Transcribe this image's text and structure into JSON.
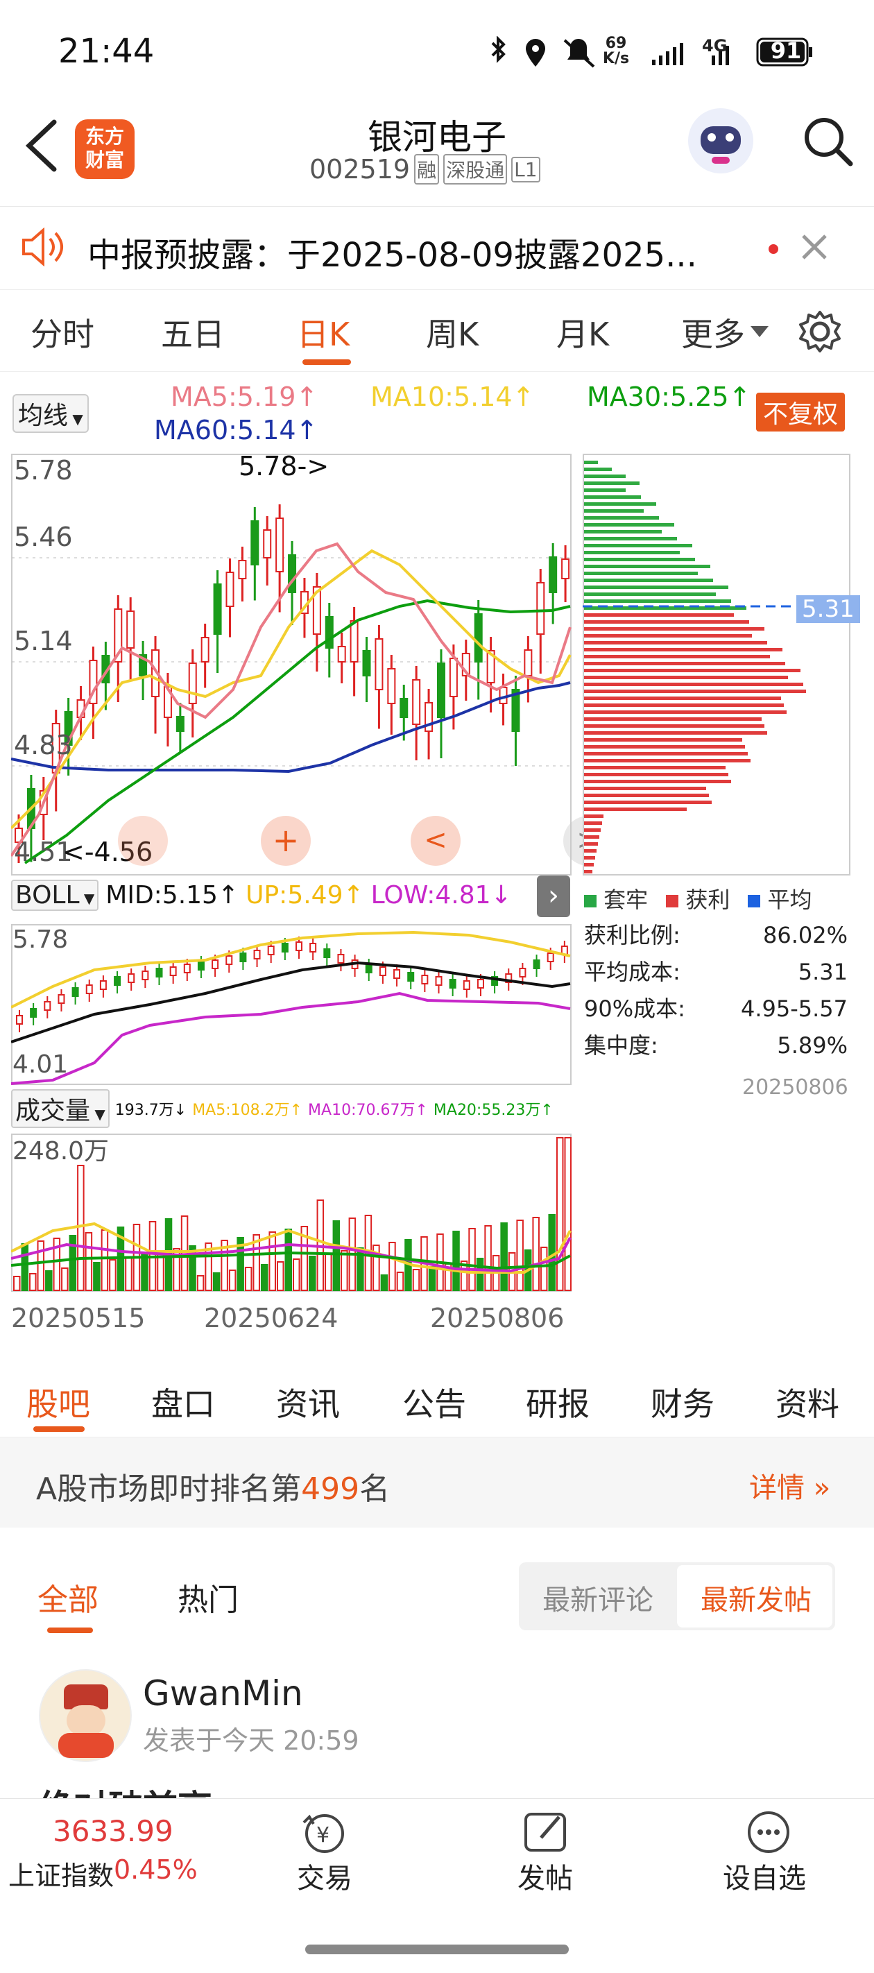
{
  "status": {
    "time": "21:44",
    "net_speed_value": "69",
    "net_speed_unit": "K/s",
    "signal": "4G",
    "battery": "91"
  },
  "header": {
    "logo_line1": "东方",
    "logo_line2": "财富",
    "stock_name": "银河电子",
    "stock_code": "002519",
    "tags": [
      "融",
      "深股通",
      "L1"
    ]
  },
  "notice": {
    "text": "中报预披露：于2025-08-09披露2025..."
  },
  "ktabs": [
    "分时",
    "五日",
    "日K",
    "周K",
    "月K",
    "更多"
  ],
  "active_ktab": "日K",
  "ma": {
    "selector": "均线",
    "ma5": "MA5:5.19↑",
    "ma10": "MA10:5.14↑",
    "ma30": "MA30:5.25↑",
    "ma60": "MA60:5.14↑",
    "fq": "不复权",
    "colors": {
      "ma5": "#ea7a86",
      "ma10": "#f2cf2f",
      "ma30": "#0d9e0f",
      "ma60": "#1d33a6"
    }
  },
  "kchart": {
    "y_labels": [
      "5.78",
      "5.46",
      "5.14",
      "4.83",
      "4.51"
    ],
    "max_label": "5.78->",
    "min_label": "<-4.56",
    "tooltip_price": "5.31"
  },
  "chip": {
    "legend": [
      "套牢",
      "获利",
      "平均"
    ],
    "rows": [
      {
        "label": "获利比例:",
        "value": "86.02%"
      },
      {
        "label": "平均成本:",
        "value": "5.31"
      },
      {
        "label": "90%成本:",
        "value": "4.95-5.57"
      },
      {
        "label": "集中度:",
        "value": "5.89%"
      }
    ],
    "date": "20250806"
  },
  "boll": {
    "selector": "BOLL",
    "mid": "MID:5.15↑",
    "up": "UP:5.49↑",
    "low": "LOW:4.81↓",
    "top": "5.78",
    "bottom": "4.01"
  },
  "volume": {
    "selector": "成交量",
    "vol": "193.7万↓",
    "ma5": "MA5:108.2万↑",
    "ma10": "MA10:70.67万↑",
    "ma20": "MA20:55.23万↑",
    "top": "248.0万"
  },
  "dates": [
    "20250515",
    "20250624",
    "20250806"
  ],
  "bottom_tabs": [
    "股吧",
    "盘口",
    "资讯",
    "公告",
    "研报",
    "财务",
    "资料"
  ],
  "rank": {
    "prefix": "A股市场即时排名第",
    "number": "499",
    "suffix": "名",
    "detail": "详情"
  },
  "feed_tabs": {
    "all": "全部",
    "hot": "热门",
    "latest_comment": "最新评论",
    "latest_post": "最新发帖"
  },
  "post": {
    "user": "GwanMin",
    "time": "发表于今天 20:59",
    "snippet": "绝对破前高"
  },
  "nav": {
    "index_value": "3633.99",
    "index_name": "上证指数",
    "index_change": "0.45%",
    "trade": "交易",
    "post": "发帖",
    "watch": "设自选"
  },
  "chart_data": {
    "type": "candlestick",
    "ylim": [
      4.51,
      5.78
    ],
    "high_label": 5.78,
    "low_label": 4.56
  }
}
